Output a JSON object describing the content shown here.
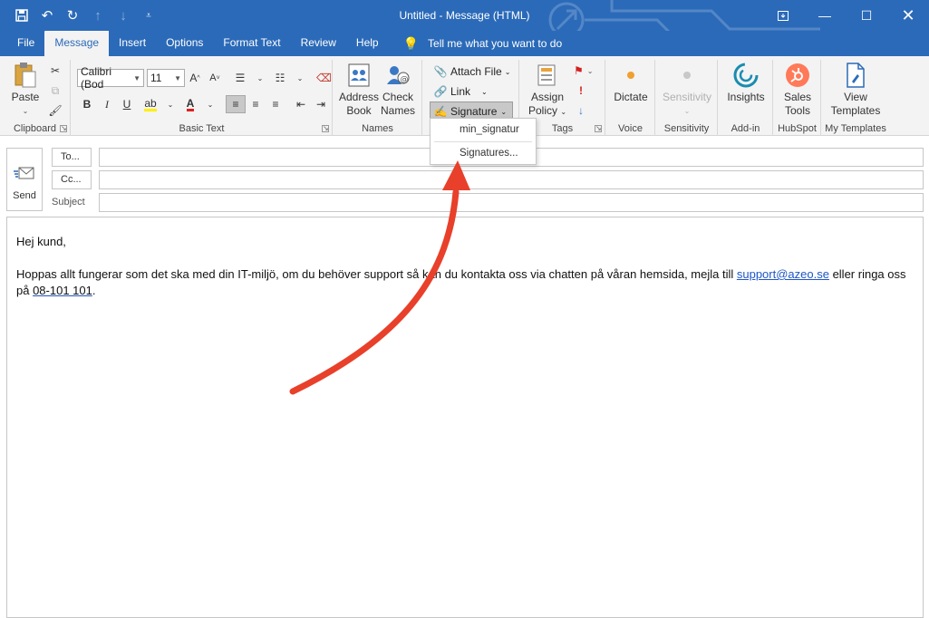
{
  "window": {
    "title": "Untitled  -  Message (HTML)"
  },
  "colors": {
    "accent": "#2b6ab8",
    "arrow": "#e8402a",
    "link": "#1e56c9"
  },
  "tabs": [
    {
      "label": "File"
    },
    {
      "label": "Message"
    },
    {
      "label": "Insert"
    },
    {
      "label": "Options"
    },
    {
      "label": "Format Text"
    },
    {
      "label": "Review"
    },
    {
      "label": "Help"
    }
  ],
  "tell_me": "Tell me what you want to do",
  "ribbon": {
    "clipboard": {
      "paste": "Paste",
      "label": "Clipboard"
    },
    "basic_text": {
      "font": "Calibri (Bod",
      "size": "11",
      "label": "Basic Text"
    },
    "names": {
      "address_book": "Address Book",
      "address_line1": "Address",
      "address_line2": "Book",
      "check_line1": "Check",
      "check_line2": "Names",
      "label": "Names"
    },
    "include": {
      "attach": "Attach File",
      "link": "Link",
      "signature": "Signature"
    },
    "tags": {
      "assign_line1": "Assign",
      "assign_line2": "Policy",
      "label": "Tags"
    },
    "voice": {
      "dictate": "Dictate",
      "label": "Voice"
    },
    "sensitivity": {
      "btn": "Sensitivity",
      "label": "Sensitivity"
    },
    "addin": {
      "insights": "Insights",
      "label": "Add-in"
    },
    "hubspot": {
      "line1": "Sales",
      "line2": "Tools",
      "label": "HubSpot"
    },
    "templates": {
      "line1": "View",
      "line2": "Templates",
      "label": "My Templates"
    }
  },
  "signature_menu": {
    "items": [
      "min_signatur",
      "Signatures..."
    ]
  },
  "header": {
    "send": "Send",
    "to": "To...",
    "cc": "Cc...",
    "subject": "Subject"
  },
  "body": {
    "greeting": "Hej kund,",
    "text_before_email": "Hoppas allt fungerar som det ska med din IT-miljö, om du behöver support så kan du kontakta oss via chatten på våran hemsida, mejla till ",
    "email": "support@azeo.se",
    "text_after_email": " eller ringa oss på ",
    "phone": "08-101 101",
    "end": "."
  }
}
